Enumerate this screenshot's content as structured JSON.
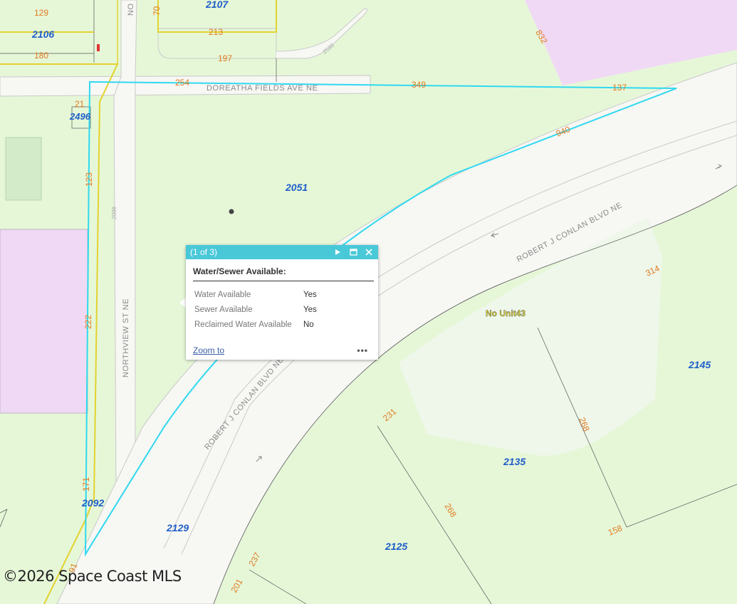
{
  "map": {
    "parcel_ids": [
      {
        "id": "p2107",
        "text": "2107"
      },
      {
        "id": "p2106",
        "text": "2106"
      },
      {
        "id": "p2496",
        "text": "2496"
      },
      {
        "id": "p2051",
        "text": "2051"
      },
      {
        "id": "p2145",
        "text": "2145"
      },
      {
        "id": "p2135",
        "text": "2135"
      },
      {
        "id": "p2125",
        "text": "2125"
      },
      {
        "id": "p2129",
        "text": "2129"
      },
      {
        "id": "p2092",
        "text": "2092"
      }
    ],
    "dimensions": [
      {
        "id": "d129",
        "text": "129"
      },
      {
        "id": "d180",
        "text": "180"
      },
      {
        "id": "d213",
        "text": "213"
      },
      {
        "id": "d197",
        "text": "197"
      },
      {
        "id": "d254",
        "text": "254"
      },
      {
        "id": "d349",
        "text": "349"
      },
      {
        "id": "d137",
        "text": "137"
      },
      {
        "id": "d940",
        "text": "940"
      },
      {
        "id": "d832",
        "text": "832"
      },
      {
        "id": "d70",
        "text": "70"
      },
      {
        "id": "d21",
        "text": "21"
      },
      {
        "id": "d123",
        "text": "123"
      },
      {
        "id": "d222",
        "text": "222"
      },
      {
        "id": "d171",
        "text": "171"
      },
      {
        "id": "d314",
        "text": "314"
      },
      {
        "id": "d231",
        "text": "231"
      },
      {
        "id": "d268a",
        "text": "268"
      },
      {
        "id": "d268b",
        "text": "268"
      },
      {
        "id": "d158",
        "text": "158"
      },
      {
        "id": "d237",
        "text": "237"
      },
      {
        "id": "d201",
        "text": "201"
      },
      {
        "id": "d91",
        "text": "91"
      }
    ],
    "street_labels": [
      {
        "id": "s1",
        "text": "DOREATHA FIELDS AVE NE"
      },
      {
        "id": "s2",
        "text": "ROBERT J CONLAN BLVD NE"
      },
      {
        "id": "s3",
        "text": "ROBERT J CONLAN BLVD NE"
      },
      {
        "id": "s4",
        "text": "NORTHVIEW ST NE"
      },
      {
        "id": "s5",
        "text": "NO"
      }
    ],
    "address_labels": [
      {
        "id": "a1",
        "text": "2599"
      },
      {
        "id": "a2",
        "text": "2098"
      }
    ],
    "unit_label": "No Unit43",
    "colors": {
      "background": "#e6f7d8",
      "road": "#f7f7f4",
      "parcel_outline": "#2fd9ef",
      "boundary": "#e3d22e",
      "purple_zone": "#f0d9f5",
      "parcel_id": "#1f5fc8",
      "dimension": "#e07a1f"
    }
  },
  "popup": {
    "counter": "(1 of 3)",
    "title": "Water/Sewer Available:",
    "rows": [
      {
        "key": "Water Available",
        "value": "Yes"
      },
      {
        "key": "Sewer Available",
        "value": "Yes"
      },
      {
        "key": "Reclaimed Water Available",
        "value": "No"
      }
    ],
    "zoom_label": "Zoom to",
    "more_label": "•••",
    "next_icon": "play-icon",
    "maximize_icon": "maximize-icon",
    "close_icon": "close-icon",
    "header_color": "#49c8d8"
  },
  "copyright": "©2026 Space Coast MLS"
}
